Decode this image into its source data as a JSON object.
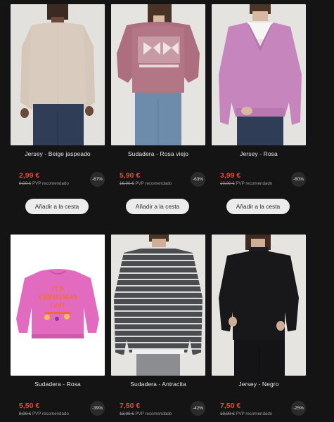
{
  "products": [
    {
      "name": "Jersey - Beige jaspeado",
      "price": "2,99 €",
      "old_price": "9,00 €",
      "rec_label": "PVP recomendado",
      "discount": "-67%",
      "cart_label": "Añadir a la cesta"
    },
    {
      "name": "Sudadera - Rosa viejo",
      "price": "5,90 €",
      "old_price": "16,00 €",
      "rec_label": "PVP recomendado",
      "discount": "-63%",
      "cart_label": "Añadir a la cesta"
    },
    {
      "name": "Jersey - Rosa",
      "price": "3,99 €",
      "old_price": "10,00 €",
      "rec_label": "PVP recomendado",
      "discount": "-60%",
      "cart_label": "Añadir a la cesta"
    },
    {
      "name": "Sudadera - Rosa",
      "price": "5,50 €",
      "old_price": "9,00 €",
      "rec_label": "PVP recomendado",
      "discount": "-39%"
    },
    {
      "name": "Sudadera - Antracita",
      "price": "7,50 €",
      "old_price": "13,00 €",
      "rec_label": "PVP recomendado",
      "discount": "-42%"
    },
    {
      "name": "Jersey - Negro",
      "price": "7,50 €",
      "old_price": "10,00 €",
      "rec_label": "PVP recomendado",
      "discount": "-25%"
    }
  ],
  "graphic_text": [
    "IT'S",
    "CHRISTMAS",
    "TIME"
  ],
  "colors": {
    "background": "#141414",
    "price": "#e8473b",
    "button": "#ececec"
  }
}
